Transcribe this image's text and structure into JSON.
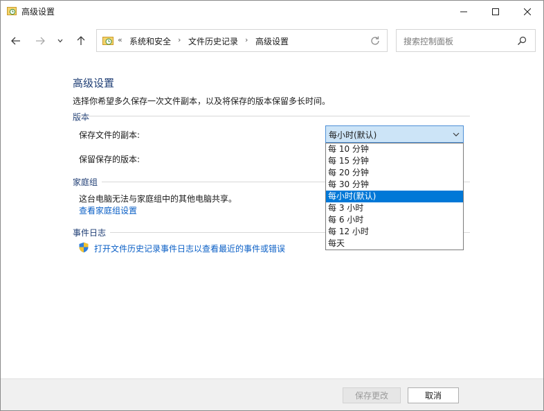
{
  "window": {
    "title": "高级设置"
  },
  "nav": {
    "breadcrumb": [
      "系统和安全",
      "文件历史记录",
      "高级设置"
    ],
    "overflow": "«",
    "search_placeholder": "搜索控制面板"
  },
  "main": {
    "title": "高级设置",
    "description": "选择你希望多久保存一次文件副本，以及将保存的版本保留多长时间。",
    "versions": {
      "heading": "版本",
      "save_copies_label": "保存文件的副本:",
      "keep_versions_label": "保留保存的版本:",
      "selected": "每小时(默认)",
      "options": [
        "每 10 分钟",
        "每 15 分钟",
        "每 20 分钟",
        "每 30 分钟",
        "每小时(默认)",
        "每 3 小时",
        "每 6 小时",
        "每 12 小时",
        "每天"
      ]
    },
    "homegroup": {
      "heading": "家庭组",
      "text": "这台电脑无法与家庭组中的其他电脑共享。",
      "link": "查看家庭组设置"
    },
    "eventlog": {
      "heading": "事件日志",
      "link": "打开文件历史记录事件日志以查看最近的事件或错误"
    }
  },
  "footer": {
    "save_label": "保存更改",
    "cancel_label": "取消"
  },
  "colors": {
    "accent": "#0078d7",
    "heading": "#1e3d74",
    "link": "#0a5fc6"
  },
  "icons": [
    "app-icon",
    "back-icon",
    "forward-icon",
    "recent-icon",
    "up-icon",
    "control-panel-icon",
    "refresh-icon",
    "search-icon",
    "shield-icon",
    "minimize-icon",
    "maximize-icon",
    "close-icon",
    "chevron-down-icon"
  ]
}
